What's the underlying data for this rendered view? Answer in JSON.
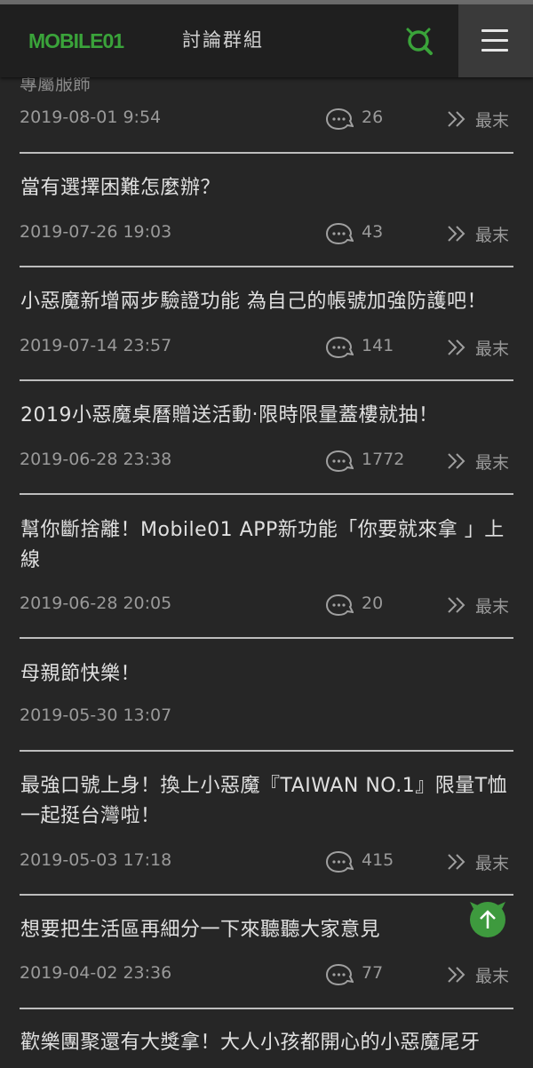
{
  "header": {
    "logo_text": "MOBILE01",
    "title": "討論群組",
    "search_icon": "search-icon",
    "menu_icon": "hamburger-menu-icon",
    "accent": "#3aa33a"
  },
  "cutoff_text": "專屬服飾",
  "topics": [
    {
      "title": "",
      "date": "2019-08-01 9:54",
      "replies": "26",
      "last": "最末"
    },
    {
      "title": "當有選擇困難怎麼辦？",
      "date": "2019-07-26 19:03",
      "replies": "43",
      "last": "最末"
    },
    {
      "title": "小惡魔新增兩步驗證功能 為自己的帳號加強防護吧！",
      "date": "2019-07-14 23:57",
      "replies": "141",
      "last": "最末"
    },
    {
      "title": "2019小惡魔桌曆贈送活動‧限時限量蓋樓就抽！",
      "date": "2019-06-28 23:38",
      "replies": "1772",
      "last": "最末"
    },
    {
      "title": "幫你斷捨離！Mobile01 APP新功能「你要就來拿 」上線",
      "date": "2019-06-28 20:05",
      "replies": "20",
      "last": "最末"
    },
    {
      "title": "母親節快樂！",
      "date": "2019-05-30 13:07",
      "replies": "",
      "last": ""
    },
    {
      "title": "最強口號上身！換上小惡魔『TAIWAN NO.1』限量T恤 一起挺台灣啦！",
      "date": "2019-05-03 17:18",
      "replies": "415",
      "last": "最末"
    },
    {
      "title": "想要把生活區再細分一下來聽聽大家意見",
      "date": "2019-04-02 23:36",
      "replies": "77",
      "last": "最末"
    },
    {
      "title": "歡樂團聚還有大獎拿！大人小孩都開心的小惡魔尾牙",
      "date": "",
      "replies": "",
      "last": ""
    }
  ],
  "back_to_top_icon": "arrow-up-icon"
}
